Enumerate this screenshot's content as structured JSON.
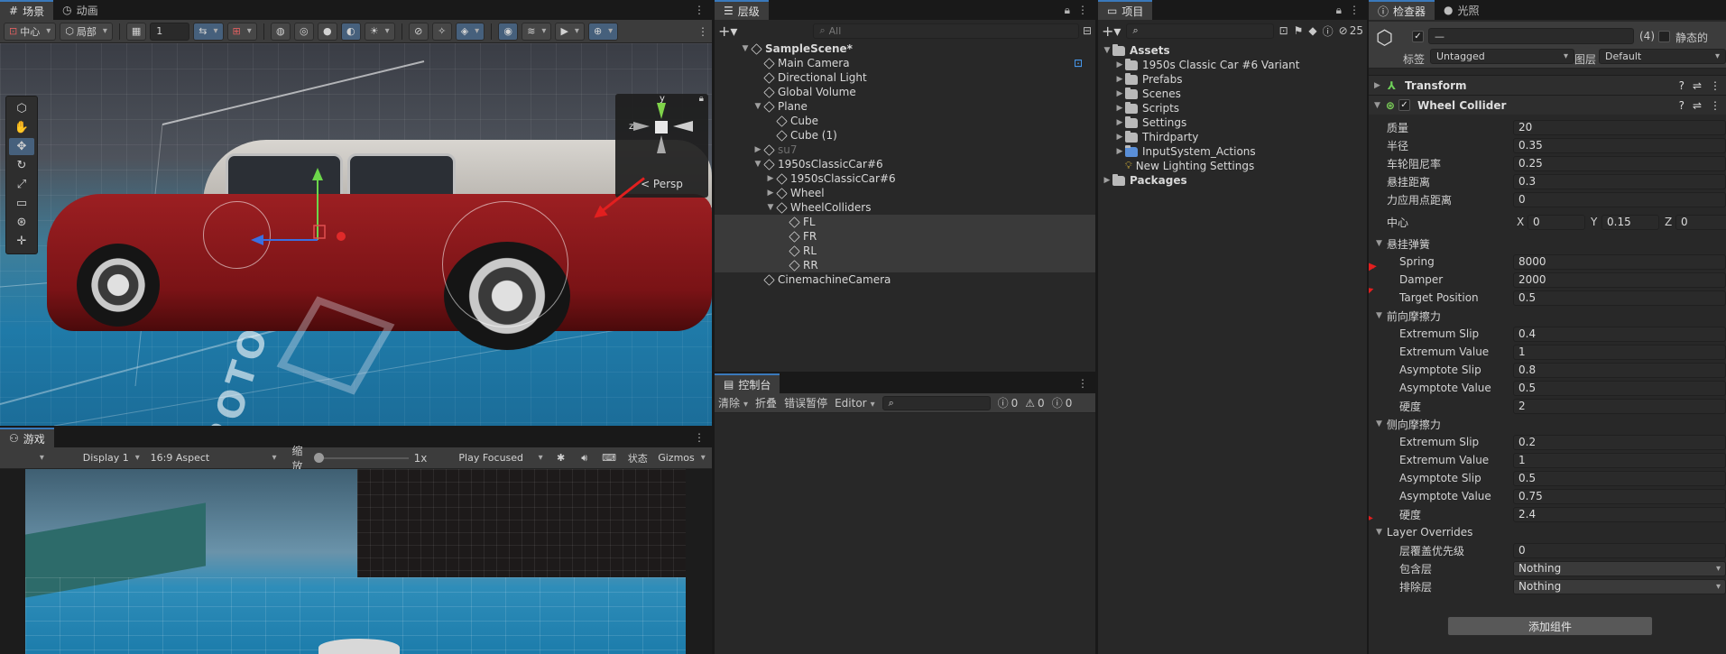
{
  "scene_panel": {
    "tabs": [
      {
        "label": "场景",
        "icon": "hash-icon"
      },
      {
        "label": "动画",
        "icon": "clock-icon"
      }
    ],
    "toolbar": {
      "pivot": "中心",
      "space": "局部",
      "snap_value": "1"
    },
    "gizmo_label": "< Persp",
    "axis_y": "y",
    "axis_z": "z",
    "axis_x": "x"
  },
  "game_panel": {
    "tab_label": "游戏",
    "display": "Display 1",
    "aspect": "16:9 Aspect",
    "scale_label": "缩放",
    "scale_value": "1x",
    "play_mode": "Play Focused",
    "stats": "状态",
    "gizmos": "Gizmos"
  },
  "hierarchy": {
    "tab_label": "层级",
    "search_placeholder": "All",
    "items": [
      {
        "label": "SampleScene*",
        "depth": 0,
        "arrow": "▼",
        "icon": "unity-scene-icon"
      },
      {
        "label": "Main Camera",
        "depth": 1,
        "arrow": "",
        "icon": "cube-icon"
      },
      {
        "label": "Directional Light",
        "depth": 1,
        "arrow": "",
        "icon": "cube-icon"
      },
      {
        "label": "Global Volume",
        "depth": 1,
        "arrow": "",
        "icon": "cube-icon"
      },
      {
        "label": "Plane",
        "depth": 1,
        "arrow": "▼",
        "icon": "cube-icon"
      },
      {
        "label": "Cube",
        "depth": 2,
        "arrow": "",
        "icon": "cube-icon"
      },
      {
        "label": "Cube (1)",
        "depth": 2,
        "arrow": "",
        "icon": "cube-icon"
      },
      {
        "label": "su7",
        "depth": 1,
        "arrow": "▶",
        "icon": "cube-icon",
        "dim": true
      },
      {
        "label": "1950sClassicCar#6",
        "depth": 1,
        "arrow": "▼",
        "icon": "cube-icon"
      },
      {
        "label": "1950sClassicCar#6",
        "depth": 2,
        "arrow": "▶",
        "icon": "cube-icon"
      },
      {
        "label": "Wheel",
        "depth": 2,
        "arrow": "▶",
        "icon": "cube-icon"
      },
      {
        "label": "WheelColliders",
        "depth": 2,
        "arrow": "▼",
        "icon": "cube-icon"
      },
      {
        "label": "FL",
        "depth": 3,
        "arrow": "",
        "icon": "cube-icon",
        "sel": true
      },
      {
        "label": "FR",
        "depth": 3,
        "arrow": "",
        "icon": "cube-icon",
        "sel": true
      },
      {
        "label": "RL",
        "depth": 3,
        "arrow": "",
        "icon": "cube-icon",
        "sel": true
      },
      {
        "label": "RR",
        "depth": 3,
        "arrow": "",
        "icon": "cube-icon",
        "sel": true
      },
      {
        "label": "CinemachineCamera",
        "depth": 1,
        "arrow": "",
        "icon": "cube-icon"
      }
    ]
  },
  "console": {
    "tab_label": "控制台",
    "clear": "清除",
    "collapse": "折叠",
    "error_pause": "错误暂停",
    "editor": "Editor",
    "count_log": "0",
    "count_warn": "0",
    "count_error": "0"
  },
  "project": {
    "tab_label": "项目",
    "count": "25",
    "items": [
      {
        "label": "Assets",
        "depth": 0,
        "arrow": "▼",
        "bold": true
      },
      {
        "label": "1950s Classic Car #6 Variant",
        "depth": 1,
        "arrow": "▶"
      },
      {
        "label": "Prefabs",
        "depth": 1,
        "arrow": "▶"
      },
      {
        "label": "Scenes",
        "depth": 1,
        "arrow": "▶"
      },
      {
        "label": "Scripts",
        "depth": 1,
        "arrow": "▶"
      },
      {
        "label": "Settings",
        "depth": 1,
        "arrow": "▶"
      },
      {
        "label": "Thirdparty",
        "depth": 1,
        "arrow": "▶"
      },
      {
        "label": "InputSystem_Actions",
        "depth": 1,
        "arrow": "▶"
      },
      {
        "label": "New Lighting Settings",
        "depth": 1,
        "arrow": ""
      },
      {
        "label": "Packages",
        "depth": 0,
        "arrow": "▶",
        "bold": true
      }
    ]
  },
  "inspector": {
    "tabs": [
      {
        "label": "检查器",
        "icon": "info-icon"
      },
      {
        "label": "光照",
        "icon": "light-bulb-icon"
      }
    ],
    "object_name": "—",
    "object_count": "(4)",
    "static_label": "静态的",
    "tag_label": "标签",
    "tag_value": "Untagged",
    "layer_label": "图层",
    "layer_value": "Default",
    "transform_title": "Transform",
    "wheel_title": "Wheel Collider",
    "props": [
      {
        "label": "质量",
        "value": "20"
      },
      {
        "label": "半径",
        "value": "0.35"
      },
      {
        "label": "车轮阻尼率",
        "value": "0.25"
      },
      {
        "label": "悬挂距离",
        "value": "0.3"
      },
      {
        "label": "力应用点距离",
        "value": "0"
      }
    ],
    "center_label": "中心",
    "center": {
      "x": "0",
      "y": "0.15",
      "z": "0"
    },
    "suspension": {
      "title": "悬挂弹簧",
      "props": [
        {
          "label": "Spring",
          "value": "8000"
        },
        {
          "label": "Damper",
          "value": "2000"
        },
        {
          "label": "Target Position",
          "value": "0.5"
        }
      ]
    },
    "forward": {
      "title": "前向摩擦力",
      "props": [
        {
          "label": "Extremum Slip",
          "value": "0.4"
        },
        {
          "label": "Extremum Value",
          "value": "1"
        },
        {
          "label": "Asymptote Slip",
          "value": "0.8"
        },
        {
          "label": "Asymptote Value",
          "value": "0.5"
        },
        {
          "label": "硬度",
          "value": "2"
        }
      ]
    },
    "sideways": {
      "title": "侧向摩擦力",
      "props": [
        {
          "label": "Extremum Slip",
          "value": "0.2"
        },
        {
          "label": "Extremum Value",
          "value": "1"
        },
        {
          "label": "Asymptote Slip",
          "value": "0.5"
        },
        {
          "label": "Asymptote Value",
          "value": "0.75"
        },
        {
          "label": "硬度",
          "value": "2.4"
        }
      ]
    },
    "layer_overrides": {
      "title": "Layer Overrides",
      "priority_label": "层覆盖优先级",
      "priority_value": "0",
      "include_label": "包含层",
      "include_value": "Nothing",
      "exclude_label": "排除层",
      "exclude_value": "Nothing"
    },
    "add_component": "添加组件"
  },
  "colors": {
    "accent": "#3a79bb",
    "annotation_red": "#e21f1f"
  }
}
